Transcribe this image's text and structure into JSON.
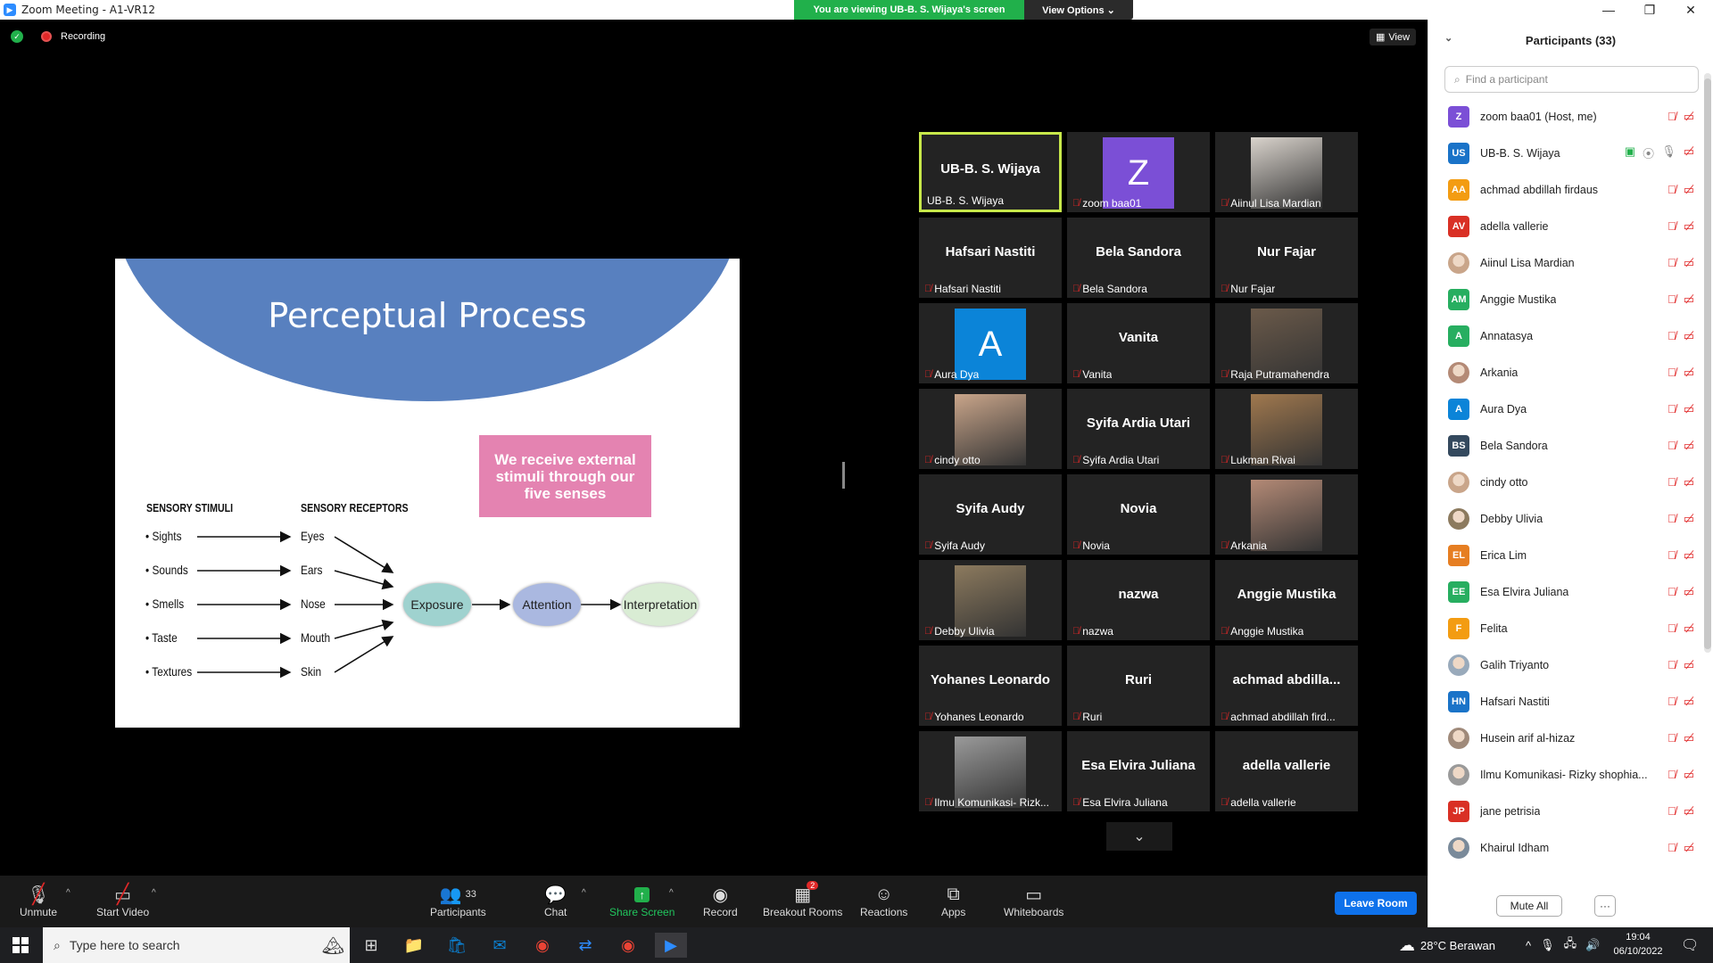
{
  "window": {
    "title": "Zoom Meeting - A1-VR12",
    "viewing_banner": "You are viewing UB-B. S. Wijaya's screen",
    "view_options": "View Options ⌄"
  },
  "meeting": {
    "recording_label": "Recording",
    "view_label": "View"
  },
  "slide": {
    "title": "Perceptual Process",
    "pink_box": "We receive external stimuli through our five senses",
    "heading_stimuli": "SENSORY STIMULI",
    "heading_receptors": "SENSORY RECEPTORS",
    "stimuli": [
      "• Sights",
      "• Sounds",
      "• Smells",
      "• Taste",
      "• Textures"
    ],
    "receptors": [
      "Eyes",
      "Ears",
      "Nose",
      "Mouth",
      "Skin"
    ],
    "stages": [
      "Exposure",
      "Attention",
      "Interpretation"
    ]
  },
  "gallery": [
    {
      "big": "UB-B. S. Wijaya",
      "label": "UB-B. S. Wijaya",
      "muted": false,
      "active": true
    },
    {
      "big": "",
      "label": "zoom baa01",
      "muted": true,
      "avatar": "Z",
      "avatar_color": "#7b4fd6"
    },
    {
      "big": "",
      "label": "Aiinul Lisa Mardian",
      "muted": true,
      "photo": "#d9d3cc"
    },
    {
      "big": "Hafsari Nastiti",
      "label": "Hafsari Nastiti",
      "muted": true
    },
    {
      "big": "Bela Sandora",
      "label": "Bela Sandora",
      "muted": true
    },
    {
      "big": "Nur Fajar",
      "label": "Nur Fajar",
      "muted": true
    },
    {
      "big": "",
      "label": "Aura Dya",
      "muted": true,
      "avatar": "A",
      "avatar_color": "#0b84d8"
    },
    {
      "big": "Vanita",
      "label": "Vanita",
      "muted": true
    },
    {
      "big": "",
      "label": "Raja Putramahendra",
      "muted": true,
      "photo": "#6b5a4a"
    },
    {
      "big": "",
      "label": "cindy otto",
      "muted": true,
      "photo": "#c9a58a"
    },
    {
      "big": "Syifa Ardia Utari",
      "label": "Syifa Ardia Utari",
      "muted": true
    },
    {
      "big": "",
      "label": "Lukman Rivai",
      "muted": true,
      "photo": "#a0784e"
    },
    {
      "big": "Syifa Audy",
      "label": "Syifa Audy",
      "muted": true
    },
    {
      "big": "Novia",
      "label": "Novia",
      "muted": true
    },
    {
      "big": "",
      "label": "Arkania",
      "muted": true,
      "photo": "#b48a76"
    },
    {
      "big": "",
      "label": "Debby Ulivia",
      "muted": true,
      "photo": "#8c7a5e"
    },
    {
      "big": "nazwa",
      "label": "nazwa",
      "muted": true
    },
    {
      "big": "Anggie Mustika",
      "label": "Anggie Mustika",
      "muted": true
    },
    {
      "big": "Yohanes Leonardo",
      "label": "Yohanes Leonardo",
      "muted": true
    },
    {
      "big": "Ruri",
      "label": "Ruri",
      "muted": true
    },
    {
      "big": "achmad  abdilla...",
      "label": "achmad abdillah fird...",
      "muted": true
    },
    {
      "big": "",
      "label": "Ilmu Komunikasi- Rizk...",
      "muted": true,
      "photo": "#9a9a9a"
    },
    {
      "big": "Esa Elvira Juliana",
      "label": "Esa Elvira Juliana",
      "muted": true
    },
    {
      "big": "adella vallerie",
      "label": "adella vallerie",
      "muted": true
    }
  ],
  "toolbar": {
    "unmute": "Unmute",
    "start_video": "Start Video",
    "participants": "Participants",
    "participants_count": "33",
    "chat": "Chat",
    "share_screen": "Share Screen",
    "record": "Record",
    "breakout_rooms": "Breakout Rooms",
    "breakout_badge": "2",
    "reactions": "Reactions",
    "apps": "Apps",
    "whiteboards": "Whiteboards",
    "leave_room": "Leave Room"
  },
  "panel": {
    "title": "Participants (33)",
    "search_placeholder": "Find a participant",
    "mute_all": "Mute All",
    "more": "···",
    "participants": [
      {
        "initials": "Z",
        "color": "#7b4fd6",
        "name": "zoom baa01 (Host, me)"
      },
      {
        "initials": "US",
        "color": "#1a73c8",
        "name": "UB-B. S. Wijaya",
        "sharing": true
      },
      {
        "initials": "AA",
        "color": "#f39c12",
        "name": "achmad abdillah firdaus"
      },
      {
        "initials": "AV",
        "color": "#d93025",
        "name": "adella vallerie"
      },
      {
        "initials": "",
        "color": "#c9a58a",
        "name": "Aiinul Lisa Mardian",
        "photo": true
      },
      {
        "initials": "AM",
        "color": "#27ae60",
        "name": "Anggie Mustika"
      },
      {
        "initials": "A",
        "color": "#27ae60",
        "name": "Annatasya"
      },
      {
        "initials": "",
        "color": "#b48a76",
        "name": "Arkania",
        "photo": true
      },
      {
        "initials": "A",
        "color": "#0b84d8",
        "name": "Aura Dya"
      },
      {
        "initials": "BS",
        "color": "#34495e",
        "name": "Bela Sandora"
      },
      {
        "initials": "",
        "color": "#c9a58a",
        "name": "cindy otto",
        "photo": true
      },
      {
        "initials": "",
        "color": "#8c7a5e",
        "name": "Debby Ulivia",
        "photo": true
      },
      {
        "initials": "EL",
        "color": "#e67e22",
        "name": "Erica Lim"
      },
      {
        "initials": "EE",
        "color": "#27ae60",
        "name": "Esa Elvira Juliana"
      },
      {
        "initials": "F",
        "color": "#f39c12",
        "name": "Felita"
      },
      {
        "initials": "",
        "color": "#9ab",
        "name": "Galih Triyanto",
        "photo": true
      },
      {
        "initials": "HN",
        "color": "#1a73c8",
        "name": "Hafsari Nastiti"
      },
      {
        "initials": "",
        "color": "#a08a7a",
        "name": "Husein arif al-hizaz",
        "photo": true
      },
      {
        "initials": "",
        "color": "#9a9a9a",
        "name": "Ilmu Komunikasi- Rizky shophia...",
        "photo": true
      },
      {
        "initials": "JP",
        "color": "#d93025",
        "name": "jane petrisia"
      },
      {
        "initials": "",
        "color": "#7a8a9a",
        "name": "Khairul Idham",
        "photo": true
      }
    ]
  },
  "taskbar": {
    "search_placeholder": "Type here to search",
    "weather": "28°C  Berawan",
    "time": "19:04",
    "date": "06/10/2022"
  }
}
